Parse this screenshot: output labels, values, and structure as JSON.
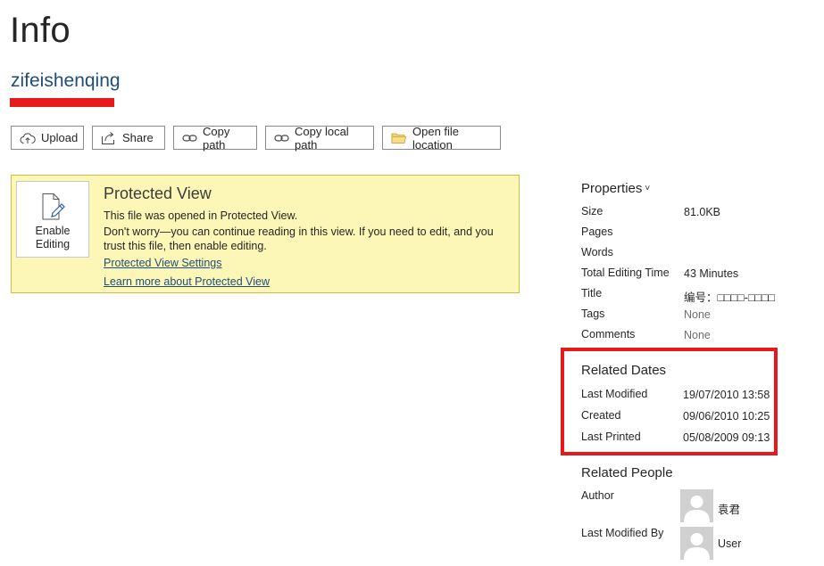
{
  "page": {
    "title": "Info",
    "doc_name": "zifeishenqing"
  },
  "actions": {
    "upload": "Upload",
    "share": "Share",
    "copy_path": "Copy path",
    "copy_local_path": "Copy local path",
    "open_file_location": "Open file location"
  },
  "protected_view": {
    "enable_line1": "Enable",
    "enable_line2": "Editing",
    "title": "Protected View",
    "line1": "This file was opened in Protected View.",
    "line2": "Don't worry—you can continue reading in this view. If you need to edit, and you trust this file, then enable editing.",
    "settings_link": "Protected View Settings",
    "learn_link": "Learn more about Protected View"
  },
  "properties": {
    "title": "Properties",
    "rows": [
      {
        "label": "Size",
        "value": "81.0KB",
        "muted": false
      },
      {
        "label": "Pages",
        "value": "",
        "muted": false
      },
      {
        "label": "Words",
        "value": "",
        "muted": false
      },
      {
        "label": "Total Editing Time",
        "value": "43 Minutes",
        "muted": false
      },
      {
        "label": "Title",
        "value": "编号：□□□□-□□□□",
        "muted": false
      },
      {
        "label": "Tags",
        "value": "None",
        "muted": true
      },
      {
        "label": "Comments",
        "value": "None",
        "muted": true
      }
    ]
  },
  "related_dates": {
    "title": "Related Dates",
    "rows": [
      {
        "label": "Last Modified",
        "value": "19/07/2010 13:58"
      },
      {
        "label": "Created",
        "value": "09/06/2010 10:25"
      },
      {
        "label": "Last Printed",
        "value": "05/08/2009 09:13"
      }
    ]
  },
  "related_people": {
    "title": "Related People",
    "author_label": "Author",
    "author_name": "袁君",
    "modified_label": "Last Modified By",
    "modified_name": "User"
  },
  "colors": {
    "accent": "#1e4e79",
    "highlight_red": "#e8191d",
    "banner_bg": "#fcf7b6"
  }
}
